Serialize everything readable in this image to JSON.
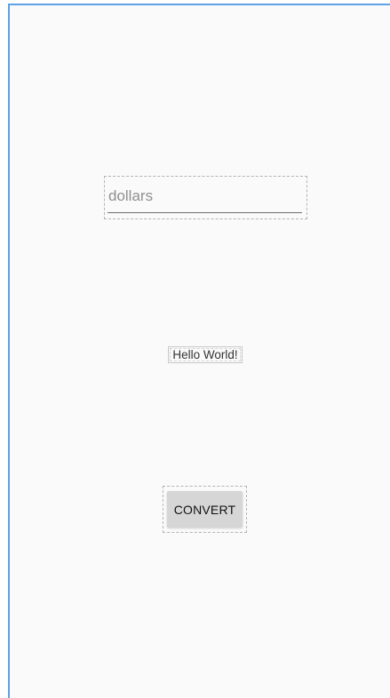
{
  "dollars_input": {
    "placeholder": "dollars",
    "value": ""
  },
  "result_label": {
    "text": "Hello World!"
  },
  "convert_button": {
    "label": "CONVERT"
  },
  "colors": {
    "background": "#fafafa",
    "frame_accent": "#5ea1e6",
    "button_bg": "#d6d6d6"
  }
}
